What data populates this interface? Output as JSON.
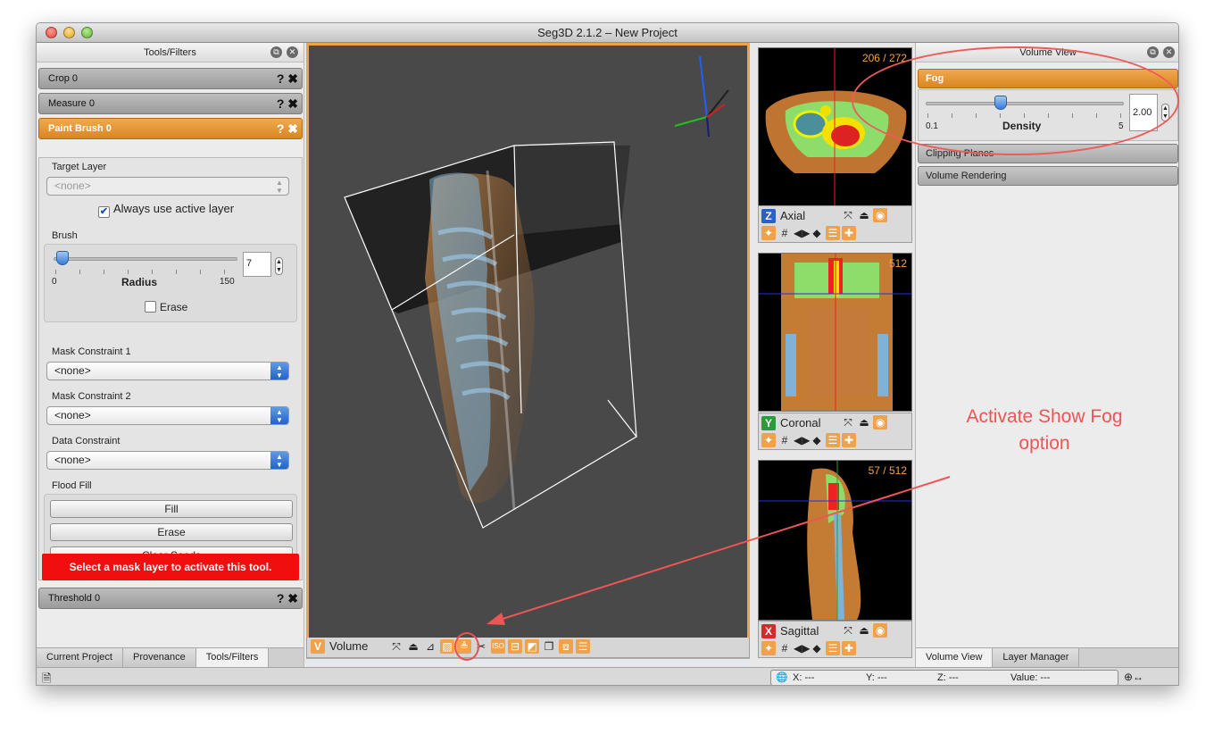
{
  "window": {
    "title": "Seg3D 2.1.2  – New Project"
  },
  "left_panel": {
    "header": "Tools/Filters",
    "tools": [
      {
        "label": "Crop 0"
      },
      {
        "label": "Measure 0"
      },
      {
        "label": "Paint Brush 0"
      },
      {
        "label": "Threshold 0"
      }
    ],
    "tool_icons": {
      "help": "?",
      "close": "✖"
    },
    "paint_brush": {
      "target_layer_label": "Target Layer",
      "target_layer_value": "<none>",
      "always_active_label": "Always use active layer",
      "brush_label": "Brush",
      "radius_label": "Radius",
      "radius_min": "0",
      "radius_max": "150",
      "radius_value": "7",
      "radius_level": 0.047,
      "erase_label": "Erase",
      "mask1_label": "Mask Constraint 1",
      "mask1_value": "<none>",
      "mask2_label": "Mask Constraint 2",
      "mask2_value": "<none>",
      "data_label": "Data Constraint",
      "data_value": "<none>",
      "flood_label": "Flood Fill",
      "fill_btn": "Fill",
      "erase_btn": "Erase",
      "clear_btn": "Clear Seeds",
      "warning": "Select a mask layer to activate this tool."
    },
    "tabs": [
      "Current Project",
      "Provenance",
      "Tools/Filters"
    ]
  },
  "volume_view": {
    "badge": "V",
    "label": "Volume",
    "badge_color": "#f0a24a"
  },
  "slices": [
    {
      "badge": "Z",
      "name": "Axial",
      "number": "206 / 272",
      "badge_color": "#2a62c4"
    },
    {
      "badge": "Y",
      "name": "Coronal",
      "number": "512",
      "badge_color": "#2a9a3a"
    },
    {
      "badge": "X",
      "name": "Sagittal",
      "number": "57 / 512",
      "badge_color": "#d52a2a"
    }
  ],
  "right_panel": {
    "header": "Volume View",
    "fog_label": "Fog",
    "density_label": "Density",
    "density_min": "0.1",
    "density_max": "5",
    "density_value": "2.00",
    "density_level": 0.38,
    "clipping_label": "Clipping Planes",
    "rendering_label": "Volume Rendering",
    "tabs": [
      "Volume View",
      "Layer Manager"
    ]
  },
  "status": {
    "x": "X: ---",
    "y": "Y: ---",
    "z": "Z: ---",
    "value": "Value: ---"
  },
  "annotation": {
    "line1": "Activate Show Fog",
    "line2": "option",
    "color": "#ee5555"
  }
}
